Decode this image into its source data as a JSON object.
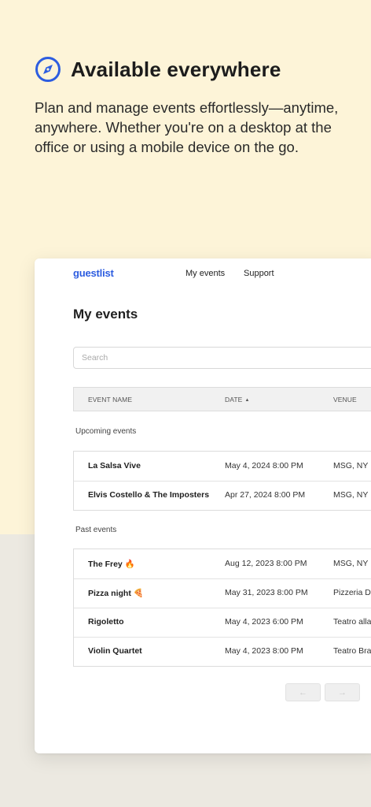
{
  "hero": {
    "icon": "compass-icon",
    "title": "Available everywhere",
    "description": "Plan and manage events effortlessly—anytime, anywhere. Whether you're on a desktop at the office or using a mobile device on the go.",
    "accent_color": "#2d5de0",
    "background_color": "#fdf4d8"
  },
  "app": {
    "brand": "guestlist",
    "nav": [
      "My events",
      "Support"
    ],
    "page_title": "My events",
    "search_placeholder": "Search",
    "columns": {
      "name": "EVENT NAME",
      "date": "DATE",
      "venue": "VENUE"
    },
    "sections": {
      "upcoming": {
        "label": "Upcoming events",
        "rows": [
          {
            "name": "La Salsa Vive",
            "date": "May 4, 2024 8:00 PM",
            "venue": "MSG, NY"
          },
          {
            "name": "Elvis Costello & The Imposters",
            "date": "Apr 27, 2024 8:00 PM",
            "venue": "MSG, NY"
          }
        ]
      },
      "past": {
        "label": "Past events",
        "rows": [
          {
            "name": "The Frey 🔥",
            "date": "Aug 12, 2023 8:00 PM",
            "venue": "MSG, NY"
          },
          {
            "name": "Pizza night 🍕",
            "date": "May 31, 2023 8:00 PM",
            "venue": "Pizzeria Da"
          },
          {
            "name": "Rigoletto",
            "date": "May 4, 2023 6:00 PM",
            "venue": "Teatro alla"
          },
          {
            "name": "Violin Quartet",
            "date": "May 4, 2023 8:00 PM",
            "venue": "Teatro Bran"
          }
        ]
      }
    },
    "pager": {
      "prev_icon": "arrow-left-icon",
      "next_icon": "arrow-right-icon",
      "prev": "←",
      "next": "→"
    }
  }
}
